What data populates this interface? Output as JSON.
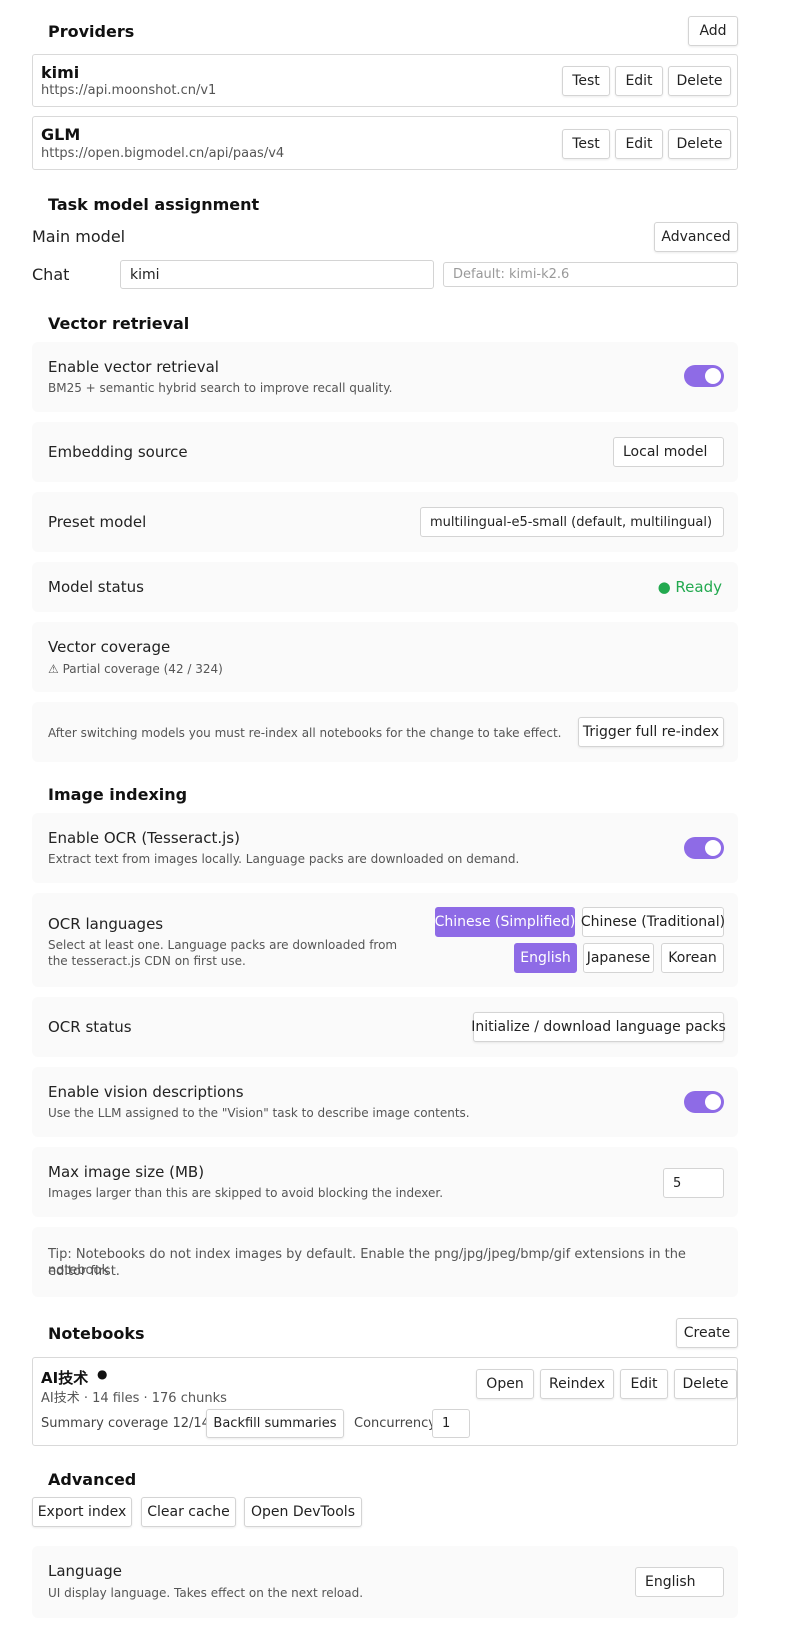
{
  "providers": {
    "title": "Providers",
    "add_label": "Add",
    "items": [
      {
        "name": "kimi",
        "url": "https://api.moonshot.cn/v1"
      },
      {
        "name": "GLM",
        "url": "https://open.bigmodel.cn/api/paas/v4"
      }
    ],
    "test_label": "Test",
    "edit_label": "Edit",
    "delete_label": "Delete"
  },
  "task_model": {
    "title": "Task model assignment",
    "main_model_label": "Main model",
    "advanced_label": "Advanced",
    "chat_label": "Chat",
    "chat_provider": "kimi",
    "chat_model_placeholder": "Default: kimi-k2.6"
  },
  "vector": {
    "title": "Vector retrieval",
    "enable_title": "Enable vector retrieval",
    "enable_desc": "BM25 + semantic hybrid search to improve recall quality.",
    "enabled": true,
    "embedding_title": "Embedding source",
    "embedding_value": "Local model",
    "preset_title": "Preset model",
    "preset_value": "multilingual-e5-small (default, multilingual)",
    "status_title": "Model status",
    "status_value": "● Ready",
    "coverage_title": "Vector coverage",
    "coverage_value": "⚠ Partial coverage (42 / 324)",
    "reindex_note": "After switching models you must re-index all notebooks for the change to take effect.",
    "reindex_label": "Trigger full re-index"
  },
  "image": {
    "title": "Image indexing",
    "ocr_title": "Enable OCR (Tesseract.js)",
    "ocr_desc": "Extract text from images locally. Language packs are downloaded on demand.",
    "ocr_enabled": true,
    "lang_title": "OCR languages",
    "lang_desc_1": "Select at least one. Language packs are downloaded from",
    "lang_desc_2": "the tesseract.js CDN on first use.",
    "languages": [
      {
        "label": "Chinese (Simplified)",
        "selected": true
      },
      {
        "label": "Chinese (Traditional)",
        "selected": false
      },
      {
        "label": "English",
        "selected": true
      },
      {
        "label": "Japanese",
        "selected": false
      },
      {
        "label": "Korean",
        "selected": false
      }
    ],
    "ocr_status_title": "OCR status",
    "ocr_init_label": "Initialize / download language packs",
    "vision_title": "Enable vision descriptions",
    "vision_desc": "Use the LLM assigned to the \"Vision\" task to describe image contents.",
    "vision_enabled": true,
    "max_title": "Max image size (MB)",
    "max_desc": "Images larger than this are skipped to avoid blocking the indexer.",
    "max_value": "5",
    "tip_1": "Tip: Notebooks do not index images by default. Enable the png/jpg/jpeg/bmp/gif extensions in the notebook",
    "tip_2": "editor first."
  },
  "notebooks": {
    "title": "Notebooks",
    "create_label": "Create",
    "item": {
      "name": "AI技术",
      "dot": "●",
      "meta": "AI技术 · 14 files · 176 chunks",
      "summary_coverage": "Summary coverage 12/14",
      "backfill_label": "Backfill summaries",
      "concurrency_label": "Concurrency",
      "concurrency_value": "1"
    },
    "open_label": "Open",
    "reindex_label": "Reindex",
    "edit_label": "Edit",
    "delete_label": "Delete"
  },
  "advanced": {
    "title": "Advanced",
    "export_label": "Export index",
    "clear_label": "Clear cache",
    "devtools_label": "Open DevTools",
    "language_title": "Language",
    "language_desc": "UI display language. Takes effect on the next reload.",
    "language_value": "English"
  },
  "colors": {
    "accent": "#8e6be6",
    "ready": "#22a94f"
  }
}
